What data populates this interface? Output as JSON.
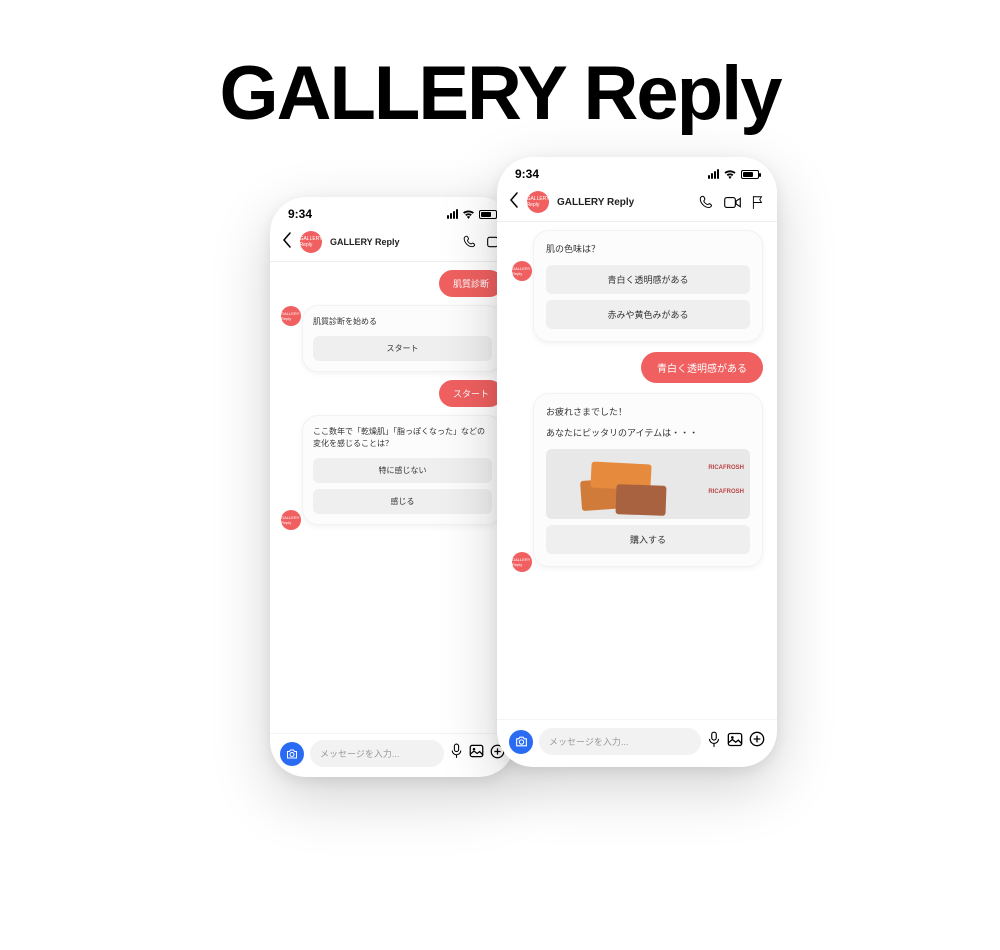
{
  "title": "GALLERY Reply",
  "colors": {
    "accent": "#f06060",
    "primary_blue": "#2a6bf3"
  },
  "status_time": "9:34",
  "header": {
    "avatar_text": "GALLERY Reply",
    "chat_title": "GALLERY Reply"
  },
  "input_placeholder": "メッセージを入力...",
  "phone_left": {
    "sent1": "肌質診断",
    "card1": {
      "title": "肌質診断を始める",
      "buttons": [
        "スタート"
      ]
    },
    "sent2": "スタート",
    "card2": {
      "title": "ここ数年で「乾燥肌」「脂っぽくなった」などの変化を感じることは？",
      "buttons": [
        "特に感じない",
        "感じる"
      ]
    }
  },
  "phone_right": {
    "card1": {
      "title": "肌の色味は？",
      "buttons": [
        "青白く透明感がある",
        "赤みや黄色みがある"
      ]
    },
    "sent1": "青白く透明感がある",
    "card2": {
      "title_line1": "お疲れさまでした！",
      "title_line2": "あなたにピッタリのアイテムは・・・",
      "brand": "RICAFROSH",
      "buttons": [
        "購入する"
      ]
    }
  }
}
